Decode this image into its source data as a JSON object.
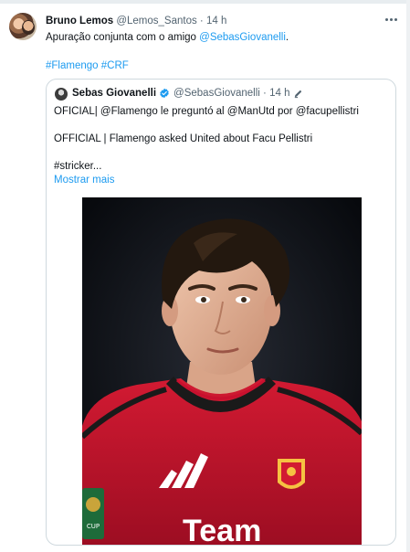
{
  "tweet": {
    "author": {
      "name": "Bruno Lemos",
      "handle": "@Lemos_Santos",
      "separator": "·",
      "time": "14 h"
    },
    "text_prefix": "Apuração conjunta com o amigo ",
    "mention": "@SebasGiovanelli",
    "text_suffix": ".",
    "hashtag_1": "#Flamengo",
    "hashtag_2": "#CRF"
  },
  "quote": {
    "author": {
      "name": "Sebas Giovanelli",
      "handle": "@SebasGiovanelli",
      "separator": "·",
      "time": "14 h"
    },
    "line1": "OFICIAL| @Flamengo le preguntó al @ManUtd por @facupellistri",
    "line2": "OFFICIAL | Flamengo asked United about Facu Pellistri",
    "line3": "#stricker...",
    "show_more": "Mostrar mais",
    "photo": {
      "sponsor_text": "Team",
      "patch_text": "CUP"
    }
  },
  "icons": {
    "more": "more-horizontal-icon",
    "verified": "verified-badge-icon",
    "edited": "pen-edit-icon"
  },
  "colors": {
    "link": "#1d9bf0",
    "muted": "#536471",
    "text": "#0f1419",
    "border": "#cfd9de",
    "jersey_red": "#c8102e"
  }
}
